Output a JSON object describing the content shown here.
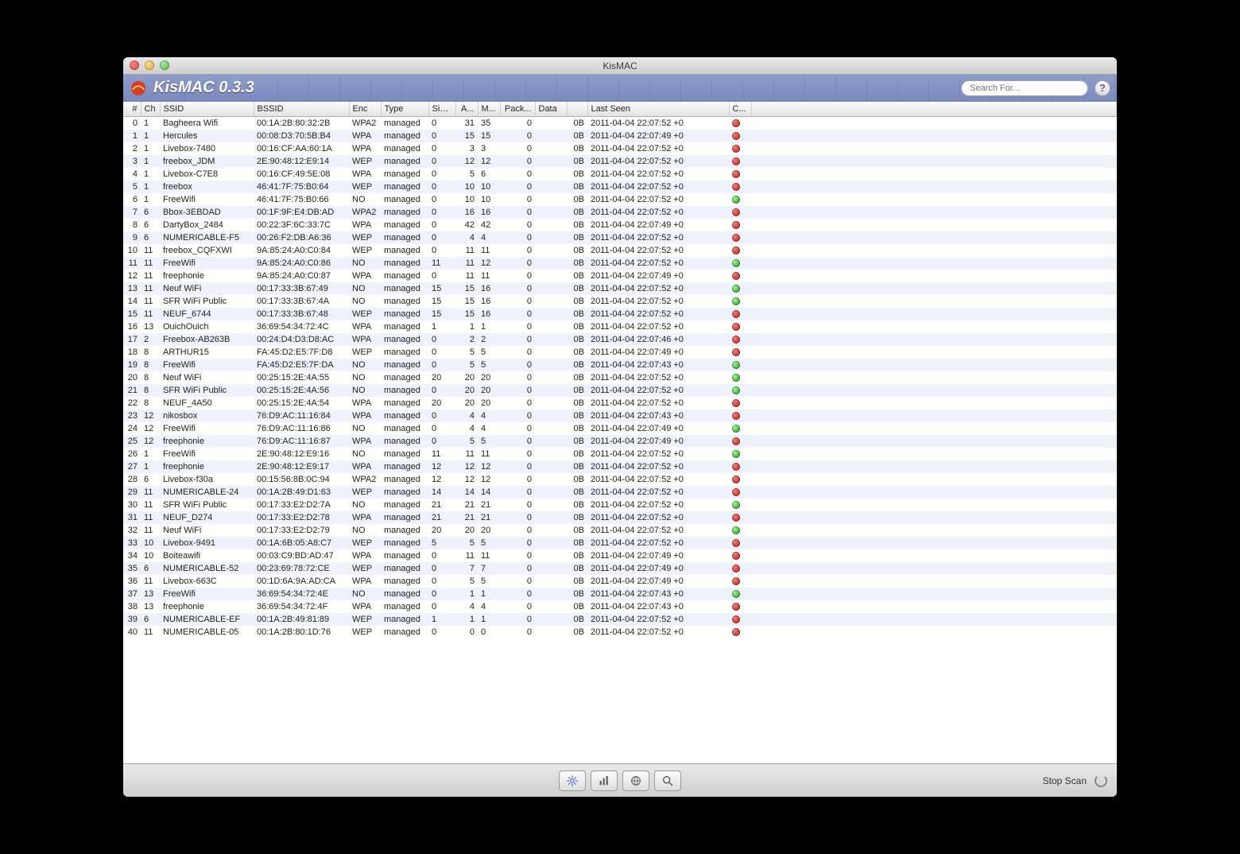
{
  "window_title": "KisMAC",
  "app_title": "KisMAC 0.3.3",
  "search_placeholder": "Search For...",
  "help_label": "?",
  "columns": {
    "num": "#",
    "ch": "Ch",
    "ssid": "SSID",
    "bssid": "BSSID",
    "enc": "Enc",
    "type": "Type",
    "sig": "Sig...",
    "a": "A...",
    "m": "M...",
    "pack": "Pack...",
    "data": "Data",
    "last": "Last Seen",
    "c": "C..."
  },
  "status": {
    "stop_scan": "Stop Scan"
  },
  "rows": [
    {
      "n": 0,
      "ch": 1,
      "ssid": "Bagheera Wifi",
      "bssid": "00:1A:2B:80:32:2B",
      "enc": "WPA2",
      "type": "managed",
      "sig": 0,
      "a": 31,
      "m": 35,
      "pack": 0,
      "gap": "0B",
      "last": "2011-04-04 22:07:52 +0",
      "dot": "red"
    },
    {
      "n": 1,
      "ch": 1,
      "ssid": "Hercules",
      "bssid": "00:08:D3:70:5B:B4",
      "enc": "WPA",
      "type": "managed",
      "sig": 0,
      "a": 15,
      "m": 15,
      "pack": 0,
      "gap": "0B",
      "last": "2011-04-04 22:07:49 +0",
      "dot": "red"
    },
    {
      "n": 2,
      "ch": 1,
      "ssid": "Livebox-7480",
      "bssid": "00:16:CF:AA:60:1A",
      "enc": "WPA",
      "type": "managed",
      "sig": 0,
      "a": 3,
      "m": 3,
      "pack": 0,
      "gap": "0B",
      "last": "2011-04-04 22:07:52 +0",
      "dot": "red"
    },
    {
      "n": 3,
      "ch": 1,
      "ssid": "freebox_JDM",
      "bssid": "2E:90:48:12:E9:14",
      "enc": "WEP",
      "type": "managed",
      "sig": 0,
      "a": 12,
      "m": 12,
      "pack": 0,
      "gap": "0B",
      "last": "2011-04-04 22:07:52 +0",
      "dot": "red"
    },
    {
      "n": 4,
      "ch": 1,
      "ssid": "Livebox-C7E8",
      "bssid": "00:16:CF:49:5E:08",
      "enc": "WPA",
      "type": "managed",
      "sig": 0,
      "a": 5,
      "m": 6,
      "pack": 0,
      "gap": "0B",
      "last": "2011-04-04 22:07:52 +0",
      "dot": "red"
    },
    {
      "n": 5,
      "ch": 1,
      "ssid": "freebox",
      "bssid": "46:41:7F:75:B0:64",
      "enc": "WEP",
      "type": "managed",
      "sig": 0,
      "a": 10,
      "m": 10,
      "pack": 0,
      "gap": "0B",
      "last": "2011-04-04 22:07:52 +0",
      "dot": "red"
    },
    {
      "n": 6,
      "ch": 1,
      "ssid": "FreeWifi",
      "bssid": "46:41:7F:75:B0:66",
      "enc": "NO",
      "type": "managed",
      "sig": 0,
      "a": 10,
      "m": 10,
      "pack": 0,
      "gap": "0B",
      "last": "2011-04-04 22:07:52 +0",
      "dot": "green"
    },
    {
      "n": 7,
      "ch": 6,
      "ssid": "Bbox-3EBDAD",
      "bssid": "00:1F:9F:E4:DB:AD",
      "enc": "WPA2",
      "type": "managed",
      "sig": 0,
      "a": 16,
      "m": 16,
      "pack": 0,
      "gap": "0B",
      "last": "2011-04-04 22:07:52 +0",
      "dot": "red"
    },
    {
      "n": 8,
      "ch": 6,
      "ssid": "DartyBox_2484",
      "bssid": "00:22:3F:6C:33:7C",
      "enc": "WPA",
      "type": "managed",
      "sig": 0,
      "a": 42,
      "m": 42,
      "pack": 0,
      "gap": "0B",
      "last": "2011-04-04 22:07:49 +0",
      "dot": "red"
    },
    {
      "n": 9,
      "ch": 6,
      "ssid": "NUMERICABLE-F5",
      "bssid": "00:26:F2:DB:A6:36",
      "enc": "WEP",
      "type": "managed",
      "sig": 0,
      "a": 4,
      "m": 4,
      "pack": 0,
      "gap": "0B",
      "last": "2011-04-04 22:07:52 +0",
      "dot": "red"
    },
    {
      "n": 10,
      "ch": 11,
      "ssid": "freebox_CQFXWI",
      "bssid": "9A:85:24:A0:C0:84",
      "enc": "WEP",
      "type": "managed",
      "sig": 0,
      "a": 11,
      "m": 11,
      "pack": 0,
      "gap": "0B",
      "last": "2011-04-04 22:07:52 +0",
      "dot": "red"
    },
    {
      "n": 11,
      "ch": 11,
      "ssid": "FreeWifi",
      "bssid": "9A:85:24:A0:C0:86",
      "enc": "NO",
      "type": "managed",
      "sig": 11,
      "a": 11,
      "m": 12,
      "pack": 0,
      "gap": "0B",
      "last": "2011-04-04 22:07:52 +0",
      "dot": "green"
    },
    {
      "n": 12,
      "ch": 11,
      "ssid": "freephonie",
      "bssid": "9A:85:24:A0:C0:87",
      "enc": "WPA",
      "type": "managed",
      "sig": 0,
      "a": 11,
      "m": 11,
      "pack": 0,
      "gap": "0B",
      "last": "2011-04-04 22:07:49 +0",
      "dot": "red"
    },
    {
      "n": 13,
      "ch": 11,
      "ssid": "Neuf WiFi",
      "bssid": "00:17:33:3B:67:49",
      "enc": "NO",
      "type": "managed",
      "sig": 15,
      "a": 15,
      "m": 16,
      "pack": 0,
      "gap": "0B",
      "last": "2011-04-04 22:07:52 +0",
      "dot": "green"
    },
    {
      "n": 14,
      "ch": 11,
      "ssid": "SFR WiFi Public",
      "bssid": "00:17:33:3B:67:4A",
      "enc": "NO",
      "type": "managed",
      "sig": 15,
      "a": 15,
      "m": 16,
      "pack": 0,
      "gap": "0B",
      "last": "2011-04-04 22:07:52 +0",
      "dot": "green"
    },
    {
      "n": 15,
      "ch": 11,
      "ssid": "NEUF_6744",
      "bssid": "00:17:33:3B:67:48",
      "enc": "WEP",
      "type": "managed",
      "sig": 15,
      "a": 15,
      "m": 16,
      "pack": 0,
      "gap": "0B",
      "last": "2011-04-04 22:07:52 +0",
      "dot": "red"
    },
    {
      "n": 16,
      "ch": 13,
      "ssid": "OuichOuich",
      "bssid": "36:69:54:34:72:4C",
      "enc": "WPA",
      "type": "managed",
      "sig": 1,
      "a": 1,
      "m": 1,
      "pack": 0,
      "gap": "0B",
      "last": "2011-04-04 22:07:52 +0",
      "dot": "red"
    },
    {
      "n": 17,
      "ch": 2,
      "ssid": "Freebox-AB263B",
      "bssid": "00:24:D4:D3:D8:AC",
      "enc": "WPA",
      "type": "managed",
      "sig": 0,
      "a": 2,
      "m": 2,
      "pack": 0,
      "gap": "0B",
      "last": "2011-04-04 22:07:46 +0",
      "dot": "red"
    },
    {
      "n": 18,
      "ch": 8,
      "ssid": "ARTHUR15",
      "bssid": "FA:45:D2:E5:7F:D8",
      "enc": "WEP",
      "type": "managed",
      "sig": 0,
      "a": 5,
      "m": 5,
      "pack": 0,
      "gap": "0B",
      "last": "2011-04-04 22:07:49 +0",
      "dot": "red"
    },
    {
      "n": 19,
      "ch": 8,
      "ssid": "FreeWifi",
      "bssid": "FA:45:D2:E5:7F:DA",
      "enc": "NO",
      "type": "managed",
      "sig": 0,
      "a": 5,
      "m": 5,
      "pack": 0,
      "gap": "0B",
      "last": "2011-04-04 22:07:43 +0",
      "dot": "green"
    },
    {
      "n": 20,
      "ch": 8,
      "ssid": "Neuf WiFi",
      "bssid": "00:25:15:2E:4A:55",
      "enc": "NO",
      "type": "managed",
      "sig": 20,
      "a": 20,
      "m": 20,
      "pack": 0,
      "gap": "0B",
      "last": "2011-04-04 22:07:52 +0",
      "dot": "green"
    },
    {
      "n": 21,
      "ch": 8,
      "ssid": "SFR WiFi Public",
      "bssid": "00:25:15:2E:4A:56",
      "enc": "NO",
      "type": "managed",
      "sig": 0,
      "a": 20,
      "m": 20,
      "pack": 0,
      "gap": "0B",
      "last": "2011-04-04 22:07:52 +0",
      "dot": "green"
    },
    {
      "n": 22,
      "ch": 8,
      "ssid": "NEUF_4A50",
      "bssid": "00:25:15:2E:4A:54",
      "enc": "WPA",
      "type": "managed",
      "sig": 20,
      "a": 20,
      "m": 20,
      "pack": 0,
      "gap": "0B",
      "last": "2011-04-04 22:07:52 +0",
      "dot": "red"
    },
    {
      "n": 23,
      "ch": 12,
      "ssid": "nikosbox",
      "bssid": "76:D9:AC:11:16:84",
      "enc": "WPA",
      "type": "managed",
      "sig": 0,
      "a": 4,
      "m": 4,
      "pack": 0,
      "gap": "0B",
      "last": "2011-04-04 22:07:43 +0",
      "dot": "red"
    },
    {
      "n": 24,
      "ch": 12,
      "ssid": "FreeWifi",
      "bssid": "76:D9:AC:11:16:86",
      "enc": "NO",
      "type": "managed",
      "sig": 0,
      "a": 4,
      "m": 4,
      "pack": 0,
      "gap": "0B",
      "last": "2011-04-04 22:07:49 +0",
      "dot": "green"
    },
    {
      "n": 25,
      "ch": 12,
      "ssid": "freephonie",
      "bssid": "76:D9:AC:11:16:87",
      "enc": "WPA",
      "type": "managed",
      "sig": 0,
      "a": 5,
      "m": 5,
      "pack": 0,
      "gap": "0B",
      "last": "2011-04-04 22:07:49 +0",
      "dot": "red"
    },
    {
      "n": 26,
      "ch": 1,
      "ssid": "FreeWifi",
      "bssid": "2E:90:48:12:E9:16",
      "enc": "NO",
      "type": "managed",
      "sig": 11,
      "a": 11,
      "m": 11,
      "pack": 0,
      "gap": "0B",
      "last": "2011-04-04 22:07:52 +0",
      "dot": "green"
    },
    {
      "n": 27,
      "ch": 1,
      "ssid": "freephonie",
      "bssid": "2E:90:48:12:E9:17",
      "enc": "WPA",
      "type": "managed",
      "sig": 12,
      "a": 12,
      "m": 12,
      "pack": 0,
      "gap": "0B",
      "last": "2011-04-04 22:07:52 +0",
      "dot": "red"
    },
    {
      "n": 28,
      "ch": 6,
      "ssid": "Livebox-f30a",
      "bssid": "00:15:56:8B:0C:94",
      "enc": "WPA2",
      "type": "managed",
      "sig": 12,
      "a": 12,
      "m": 12,
      "pack": 0,
      "gap": "0B",
      "last": "2011-04-04 22:07:52 +0",
      "dot": "red"
    },
    {
      "n": 29,
      "ch": 11,
      "ssid": "NUMERICABLE-24",
      "bssid": "00:1A:2B:49:D1:63",
      "enc": "WEP",
      "type": "managed",
      "sig": 14,
      "a": 14,
      "m": 14,
      "pack": 0,
      "gap": "0B",
      "last": "2011-04-04 22:07:52 +0",
      "dot": "red"
    },
    {
      "n": 30,
      "ch": 11,
      "ssid": "SFR WiFi Public",
      "bssid": "00:17:33:E2:D2:7A",
      "enc": "NO",
      "type": "managed",
      "sig": 21,
      "a": 21,
      "m": 21,
      "pack": 0,
      "gap": "0B",
      "last": "2011-04-04 22:07:52 +0",
      "dot": "green"
    },
    {
      "n": 31,
      "ch": 11,
      "ssid": "NEUF_D274",
      "bssid": "00:17:33:E2:D2:78",
      "enc": "WPA",
      "type": "managed",
      "sig": 21,
      "a": 21,
      "m": 21,
      "pack": 0,
      "gap": "0B",
      "last": "2011-04-04 22:07:52 +0",
      "dot": "red"
    },
    {
      "n": 32,
      "ch": 11,
      "ssid": "Neuf WiFi",
      "bssid": "00:17:33:E2:D2:79",
      "enc": "NO",
      "type": "managed",
      "sig": 20,
      "a": 20,
      "m": 20,
      "pack": 0,
      "gap": "0B",
      "last": "2011-04-04 22:07:52 +0",
      "dot": "green"
    },
    {
      "n": 33,
      "ch": 10,
      "ssid": "Livebox-9491",
      "bssid": "00:1A:6B:05:A8:C7",
      "enc": "WEP",
      "type": "managed",
      "sig": 5,
      "a": 5,
      "m": 5,
      "pack": 0,
      "gap": "0B",
      "last": "2011-04-04 22:07:52 +0",
      "dot": "red"
    },
    {
      "n": 34,
      "ch": 10,
      "ssid": "Boiteawifi",
      "bssid": "00:03:C9:BD:AD:47",
      "enc": "WPA",
      "type": "managed",
      "sig": 0,
      "a": 11,
      "m": 11,
      "pack": 0,
      "gap": "0B",
      "last": "2011-04-04 22:07:49 +0",
      "dot": "red"
    },
    {
      "n": 35,
      "ch": 6,
      "ssid": "NUMERICABLE-52",
      "bssid": "00:23:69:78:72:CE",
      "enc": "WEP",
      "type": "managed",
      "sig": 0,
      "a": 7,
      "m": 7,
      "pack": 0,
      "gap": "0B",
      "last": "2011-04-04 22:07:49 +0",
      "dot": "red"
    },
    {
      "n": 36,
      "ch": 11,
      "ssid": "Livebox-663C",
      "bssid": "00:1D:6A:9A:AD:CA",
      "enc": "WPA",
      "type": "managed",
      "sig": 0,
      "a": 5,
      "m": 5,
      "pack": 0,
      "gap": "0B",
      "last": "2011-04-04 22:07:49 +0",
      "dot": "red"
    },
    {
      "n": 37,
      "ch": 13,
      "ssid": "FreeWifi",
      "bssid": "36:69:54:34:72:4E",
      "enc": "NO",
      "type": "managed",
      "sig": 0,
      "a": 1,
      "m": 1,
      "pack": 0,
      "gap": "0B",
      "last": "2011-04-04 22:07:43 +0",
      "dot": "green"
    },
    {
      "n": 38,
      "ch": 13,
      "ssid": "freephonie",
      "bssid": "36:69:54:34:72:4F",
      "enc": "WPA",
      "type": "managed",
      "sig": 0,
      "a": 4,
      "m": 4,
      "pack": 0,
      "gap": "0B",
      "last": "2011-04-04 22:07:43 +0",
      "dot": "red"
    },
    {
      "n": 39,
      "ch": 6,
      "ssid": "NUMERICABLE-EF",
      "bssid": "00:1A:2B:49:81:89",
      "enc": "WEP",
      "type": "managed",
      "sig": 1,
      "a": 1,
      "m": 1,
      "pack": 0,
      "gap": "0B",
      "last": "2011-04-04 22:07:52 +0",
      "dot": "red"
    },
    {
      "n": 40,
      "ch": 11,
      "ssid": "NUMERICABLE-05",
      "bssid": "00:1A:2B:80:1D:76",
      "enc": "WEP",
      "type": "managed",
      "sig": 0,
      "a": 0,
      "m": 0,
      "pack": 0,
      "gap": "0B",
      "last": "2011-04-04 22:07:52 +0",
      "dot": "red"
    }
  ]
}
